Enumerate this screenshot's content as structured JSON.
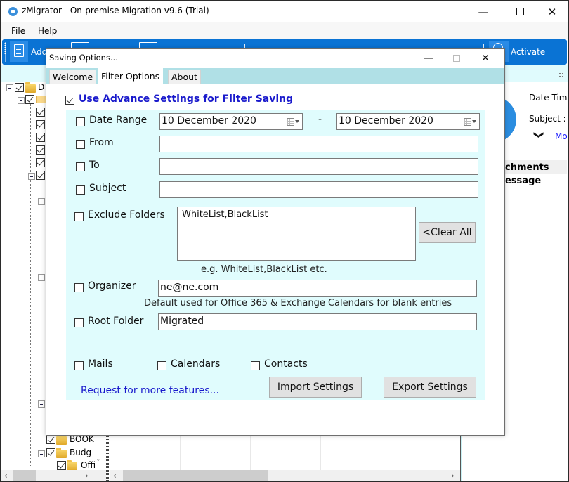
{
  "window": {
    "title": "zMigrator - On-premise Migration v9.6 (Trial)",
    "minimize": "—",
    "close": "✕"
  },
  "menu": {
    "items": [
      "File",
      "Help"
    ]
  },
  "ribbon": {
    "add_label": "Add",
    "activate_label": "Activate"
  },
  "tree": {
    "root_label": "D",
    "items": [
      {
        "label": "BOOK"
      },
      {
        "label": "Budg"
      },
      {
        "label": "Offi"
      }
    ]
  },
  "preview": {
    "date_time_label": "Date Tim",
    "subject_label": "Subject :",
    "more_label": "Mo",
    "chevron": "❯",
    "attachments_header": "chments",
    "message_label": "essage"
  },
  "dialog": {
    "title": "Saving Options...",
    "minimize": "—",
    "close": "✕",
    "tabs": [
      {
        "label": "Welcome",
        "active": false
      },
      {
        "label": "Filter Options",
        "active": true
      },
      {
        "label": "About",
        "active": false
      }
    ],
    "use_advance": {
      "label": "Use Advance Settings for Filter Saving",
      "checked": true
    },
    "filters": {
      "date_range": {
        "label": "Date Range",
        "checked": false,
        "from_value": "10  December  2020",
        "separator": "-",
        "to_value": "10  December  2020"
      },
      "from": {
        "label": "From",
        "checked": false,
        "value": ""
      },
      "to": {
        "label": "To",
        "checked": false,
        "value": ""
      },
      "subject": {
        "label": "Subject",
        "checked": false,
        "value": ""
      },
      "exclude_folders": {
        "label": "Exclude Folders",
        "checked": false,
        "value": "WhiteList,BlackList",
        "hint": "e.g. WhiteList,BlackList etc.",
        "clear_button": "<Clear All"
      },
      "organizer": {
        "label": "Organizer",
        "checked": false,
        "value": "ne@ne.com",
        "hint": "Default used for Office 365 & Exchange Calendars for blank entries"
      },
      "root_folder": {
        "label": "Root Folder",
        "checked": false,
        "value": "Migrated"
      }
    },
    "item_types": [
      {
        "label": "Mails",
        "checked": false
      },
      {
        "label": "Calendars",
        "checked": false
      },
      {
        "label": "Contacts",
        "checked": false
      }
    ],
    "request_link": "Request for more features...",
    "import_button": "Import Settings",
    "export_button": "Export Settings"
  },
  "scroll": {
    "left": "‹",
    "right": "›",
    "down": "˅"
  }
}
